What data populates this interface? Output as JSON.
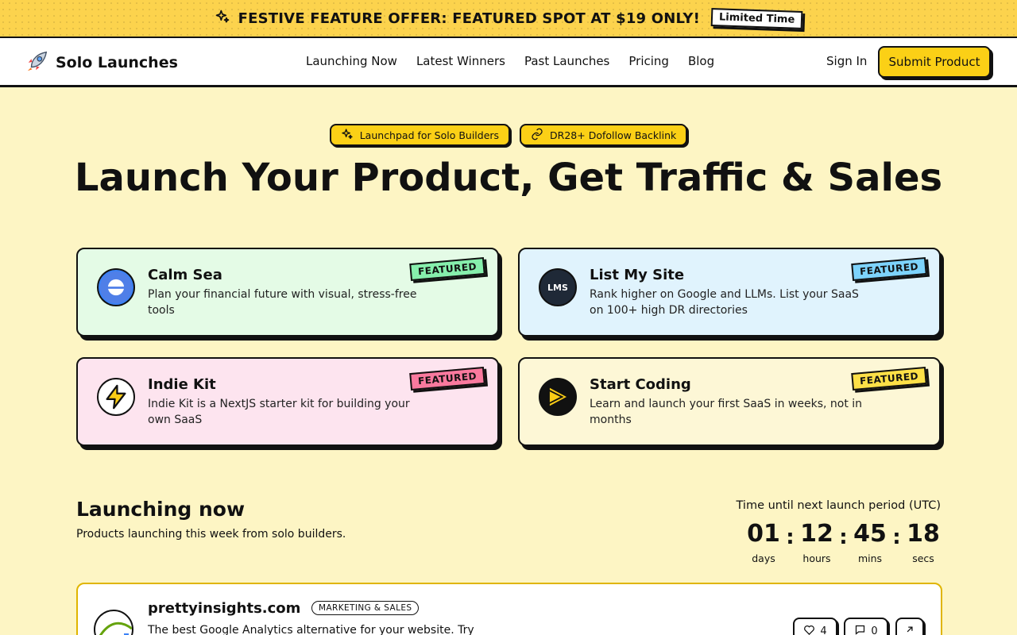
{
  "promo": {
    "text": "FESTIVE FEATURE OFFER: FEATURED SPOT AT $19 ONLY!",
    "badge": "Limited Time",
    "icon": "sparkles-icon"
  },
  "nav": {
    "brand": "Solo Launches",
    "links": [
      "Launching Now",
      "Latest Winners",
      "Past Launches",
      "Pricing",
      "Blog"
    ],
    "signin": "Sign In",
    "submit": "Submit Product"
  },
  "hero": {
    "pills": [
      {
        "label": "Launchpad for Solo Builders",
        "icon": "sparkles-icon"
      },
      {
        "label": "DR28+ Dofollow Backlink",
        "icon": "link-icon"
      }
    ],
    "title": "Launch Your Product, Get Traffic & Sales"
  },
  "featured": [
    {
      "name": "Calm Sea",
      "desc": "Plan your financial future with visual, stress-free tools",
      "tag": "FEATURED",
      "bg": "#e4fbe6",
      "tag_bg": "#86efac",
      "icon": "calm-sea-logo"
    },
    {
      "name": "List My Site",
      "desc": "Rank higher on Google and LLMs. List your SaaS on 100+ high DR directories",
      "tag": "FEATURED",
      "bg": "#e0f3fd",
      "tag_bg": "#7dd3fc",
      "icon": "lms-logo",
      "icon_text": "LMS"
    },
    {
      "name": "Indie Kit",
      "desc": "Indie Kit is a NextJS starter kit for building your own SaaS",
      "tag": "FEATURED",
      "bg": "#fde4ef",
      "tag_bg": "#f9799e",
      "icon": "lightning-icon"
    },
    {
      "name": "Start Coding",
      "desc": "Learn and launch your first SaaS in weeks, not in months",
      "tag": "FEATURED",
      "bg": "#fdf7d6",
      "tag_bg": "#fde047",
      "icon": "play-logo"
    }
  ],
  "launching": {
    "title": "Launching now",
    "subtitle": "Products launching this week from solo builders.",
    "timer_label": "Time until next launch period (UTC)",
    "timer": [
      {
        "value": "01",
        "label": "days"
      },
      {
        "value": "12",
        "label": "hours"
      },
      {
        "value": "45",
        "label": "mins"
      },
      {
        "value": "18",
        "label": "secs"
      }
    ]
  },
  "product": {
    "name": "prettyinsights.com",
    "category": "MARKETING & SALES",
    "desc": "The best Google Analytics alternative for your website. Try",
    "likes": "4",
    "comments": "0"
  }
}
